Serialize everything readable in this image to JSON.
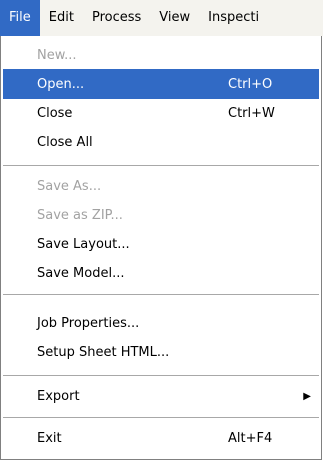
{
  "menubar": {
    "items": [
      "File",
      "Edit",
      "Process",
      "View",
      "Inspecti"
    ]
  },
  "file_menu": {
    "items": {
      "new": {
        "label": "New..."
      },
      "open": {
        "label": "Open...",
        "shortcut": "Ctrl+O"
      },
      "close": {
        "label": "Close",
        "shortcut": "Ctrl+W"
      },
      "close_all": {
        "label": "Close All"
      },
      "save_as": {
        "label": "Save As..."
      },
      "save_as_zip": {
        "label": "Save as ZIP..."
      },
      "save_layout": {
        "label": "Save Layout..."
      },
      "save_model": {
        "label": "Save Model..."
      },
      "job_properties": {
        "label": "Job Properties..."
      },
      "setup_sheet_html": {
        "label": "Setup Sheet HTML..."
      },
      "export": {
        "label": "Export",
        "submenu_icon": "triangle-right-icon"
      },
      "exit": {
        "label": "Exit",
        "shortcut": "Alt+F4"
      }
    }
  },
  "colors": {
    "highlight": "#316ac5",
    "disabled_text": "#a2a2a2",
    "menubar_bg": "#f4f3ee"
  }
}
